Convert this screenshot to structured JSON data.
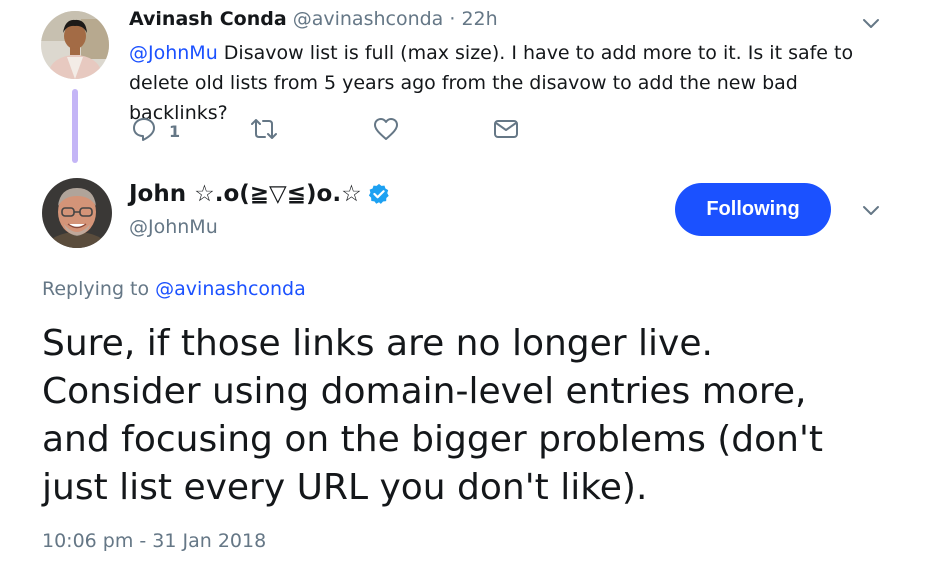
{
  "parent_tweet": {
    "author_name": "Avinash Conda",
    "author_handle": "@avinashconda",
    "separator": "·",
    "time_ago": "22h",
    "mention": "@JohnMu",
    "text": " Disavow list is full (max size). I have to add more to it. Is it safe to delete old lists from 5 years ago from the disavow to add the new bad backlinks?",
    "reply_count": "1",
    "icons": [
      "reply-icon",
      "retweet-icon",
      "like-icon",
      "dm-icon",
      "chevron-down-icon"
    ]
  },
  "main_tweet": {
    "author_name": "John ☆.o(≧▽≦)o.☆",
    "author_handle": "@JohnMu",
    "follow_button_label": "Following",
    "replying_prefix": "Replying to ",
    "replying_to": "@avinashconda",
    "text_lines": [
      "Sure, if those links are no longer live.",
      "Consider using domain-level entries more,",
      "and focusing on the bigger problems (don't",
      "just list every URL you don't like)."
    ],
    "timestamp": "10:06 pm - 31 Jan 2018",
    "icons": [
      "verified-badge-icon",
      "chevron-down-icon"
    ]
  },
  "colors": {
    "accent": "#1b51ff",
    "secondary_text": "#657786",
    "primary_text": "#14171a",
    "thread_line": "#c4b5f6",
    "verified": "#1da1f2"
  }
}
